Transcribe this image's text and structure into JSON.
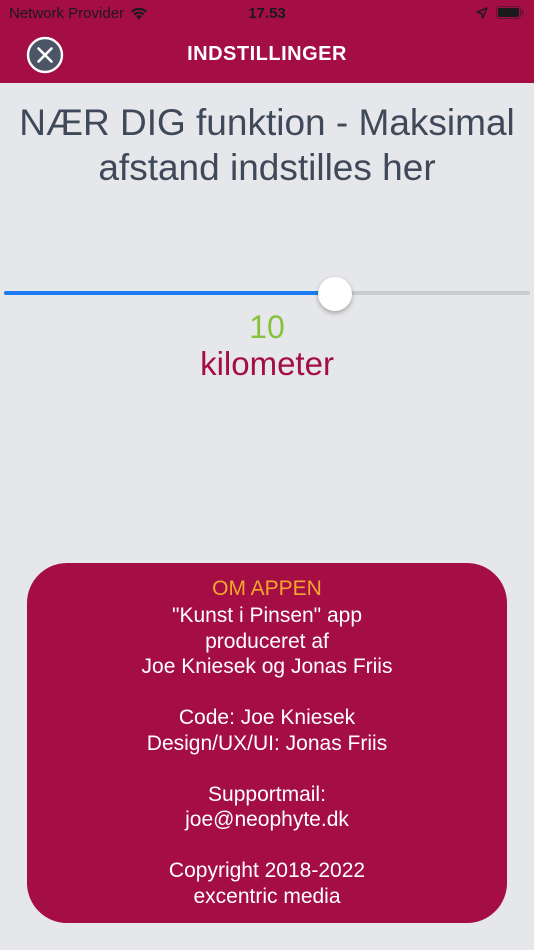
{
  "status_bar": {
    "carrier": "Network Provider",
    "time": "17.53"
  },
  "nav": {
    "title": "INDSTILLINGER",
    "close_icon": "close-circle-icon"
  },
  "heading": "NÆR DIG funktion - Maksimal afstand indstilles her",
  "slider": {
    "value": 10,
    "fraction": 0.63
  },
  "distance": {
    "value": "10",
    "unit": "kilometer"
  },
  "about": {
    "title": "OM APPEN",
    "lines": [
      "\"Kunst i Pinsen\" app",
      "produceret af",
      "Joe Kniesek og Jonas Friis",
      "",
      "Code: Joe Kniesek",
      "Design/UX/UI: Jonas Friis",
      "",
      "Supportmail:",
      "joe@neophyte.dk",
      "",
      "Copyright 2018-2022",
      "excentric media"
    ]
  },
  "colors": {
    "brand": "#a40e44",
    "accent_orange": "#f4a62a",
    "value_green": "#86c23b",
    "slider_blue": "#1a7cf0",
    "background": "#e6e7ea"
  }
}
